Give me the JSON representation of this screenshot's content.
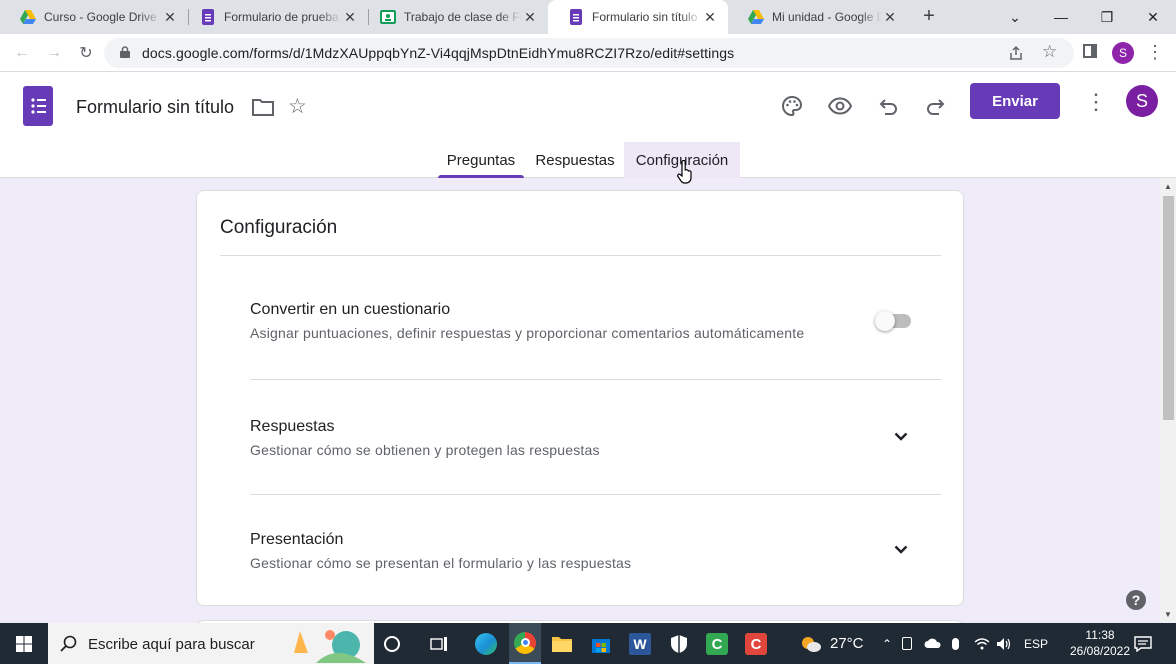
{
  "browser": {
    "tabs": [
      {
        "title": "Curso - Google Drive",
        "favicon": "google-drive-icon"
      },
      {
        "title": "Formulario de prueba",
        "favicon": "google-forms-icon"
      },
      {
        "title": "Trabajo de clase de Fo",
        "favicon": "classroom-icon"
      },
      {
        "title": "Formulario sin título",
        "favicon": "google-forms-icon",
        "active": true
      },
      {
        "title": "Mi unidad - Google Dr",
        "favicon": "google-drive-icon"
      }
    ],
    "new_tab": "+",
    "url": "docs.google.com/forms/d/1MdzXAUppqbYnZ-Vi4qqjMspDtnEidhYmu8RCZI7Rzo/edit#settings",
    "profile_initial": "S"
  },
  "app": {
    "doc_title": "Formulario sin título",
    "send_label": "Enviar",
    "avatar_initial": "S",
    "accent": "#673ab7",
    "tabs": [
      {
        "label": "Preguntas",
        "selected": true
      },
      {
        "label": "Respuestas"
      },
      {
        "label": "Configuración",
        "hover": true
      }
    ]
  },
  "settings": {
    "title": "Configuración",
    "quiz": {
      "title": "Convertir en un cuestionario",
      "subtitle": "Asignar puntuaciones, definir respuestas y proporcionar comentarios automáticamente",
      "enabled": false
    },
    "sections": [
      {
        "title": "Respuestas",
        "subtitle": "Gestionar cómo se obtienen y protegen las respuestas"
      },
      {
        "title": "Presentación",
        "subtitle": "Gestionar cómo se presentan el formulario y las respuestas"
      }
    ]
  },
  "taskbar": {
    "search_placeholder": "Escribe aquí para buscar",
    "weather": "27°C",
    "language": "ESP",
    "time": "11:38",
    "date": "26/08/2022"
  }
}
